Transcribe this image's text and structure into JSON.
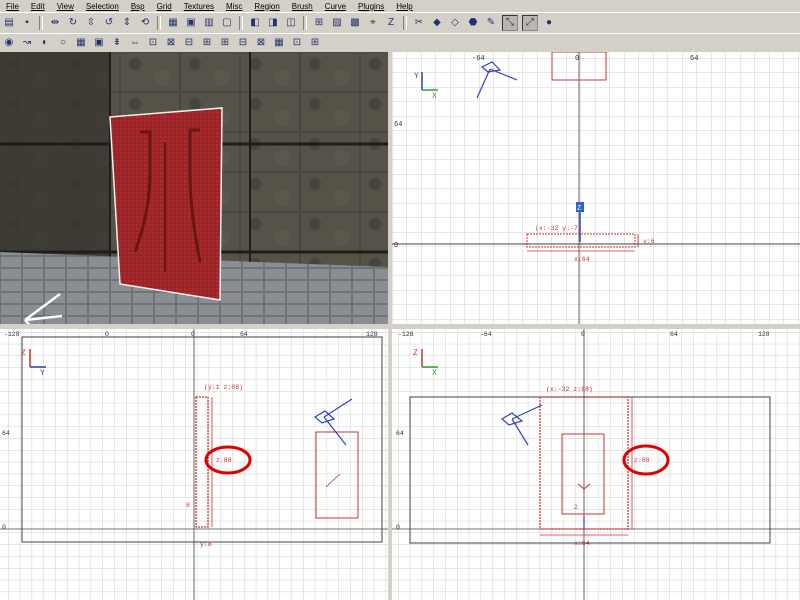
{
  "menu": [
    "File",
    "Edit",
    "View",
    "Selection",
    "Bsp",
    "Grid",
    "Textures",
    "Misc",
    "Region",
    "Brush",
    "Curve",
    "Plugins",
    "Help"
  ],
  "toolbar1": [
    {
      "icon": "open-folder-icon",
      "glyph": "▤"
    },
    {
      "icon": "save-icon",
      "glyph": "▪"
    },
    {
      "sep": true
    },
    {
      "icon": "flip-x-icon",
      "glyph": "⇹"
    },
    {
      "icon": "rotate-x-icon",
      "glyph": "↻"
    },
    {
      "icon": "flip-y-icon",
      "glyph": "⇳"
    },
    {
      "icon": "rotate-y-icon",
      "glyph": "↺"
    },
    {
      "icon": "flip-z-icon",
      "glyph": "⇕"
    },
    {
      "icon": "rotate-z-icon",
      "glyph": "⟲"
    },
    {
      "sep": true
    },
    {
      "icon": "select-complete-tall-icon",
      "glyph": "▦"
    },
    {
      "icon": "select-touching-icon",
      "glyph": "▣"
    },
    {
      "icon": "select-partial-tall-icon",
      "glyph": "▥"
    },
    {
      "icon": "select-inside-icon",
      "glyph": "▢"
    },
    {
      "sep": true
    },
    {
      "icon": "csg-subtract-icon",
      "glyph": "◧"
    },
    {
      "icon": "csg-merge-icon",
      "glyph": "◨"
    },
    {
      "icon": "hollow-icon",
      "glyph": "◫"
    },
    {
      "sep": true
    },
    {
      "icon": "change-views-icon",
      "glyph": "⊞"
    },
    {
      "icon": "texture-view-icon",
      "glyph": "▨"
    },
    {
      "icon": "cubic-clip-icon",
      "glyph": "▩"
    },
    {
      "icon": "camera-move-icon",
      "glyph": "⌖"
    },
    {
      "icon": "entity-icon",
      "glyph": "Z"
    },
    {
      "sep": true
    },
    {
      "icon": "clipper-icon",
      "glyph": "✂"
    },
    {
      "icon": "drag-edges-icon",
      "glyph": "◆"
    },
    {
      "icon": "drag-vertices-icon",
      "glyph": "◇"
    },
    {
      "icon": "patch-icon",
      "glyph": "⬣"
    },
    {
      "icon": "brush-icon",
      "glyph": "✎"
    },
    {
      "icon": "select-entity-icon",
      "glyph": "⤡",
      "pressed": true
    },
    {
      "icon": "scale-icon",
      "glyph": "⤢",
      "pressed": true
    },
    {
      "icon": "point-icon",
      "glyph": "●"
    }
  ],
  "toolbar2": [
    {
      "icon": "patch-select-icon",
      "glyph": "◉"
    },
    {
      "icon": "show-paths-icon",
      "glyph": "↝"
    },
    {
      "icon": "bend-icon",
      "glyph": "◐"
    },
    {
      "icon": "cap-icon",
      "glyph": "○"
    },
    {
      "icon": "matrix-icon",
      "glyph": "▦"
    },
    {
      "icon": "drill-icon",
      "glyph": "▣"
    },
    {
      "icon": "thicken-icon",
      "glyph": "⇟"
    },
    {
      "icon": "redisperse-icon",
      "glyph": "⇔"
    },
    {
      "icon": "weld-icon",
      "glyph": "⊡"
    },
    {
      "icon": "split-icon",
      "glyph": "⊠"
    },
    {
      "icon": "cap-cycle-icon",
      "glyph": "⊟"
    },
    {
      "icon": "invert-icon",
      "glyph": "⊞"
    },
    {
      "icon": "insert-row-icon",
      "glyph": "⊞"
    },
    {
      "icon": "delete-row-icon",
      "glyph": "⊟"
    },
    {
      "icon": "overlay-icon",
      "glyph": "⊠"
    },
    {
      "icon": "natural-icon",
      "glyph": "▦"
    },
    {
      "icon": "fit-icon",
      "glyph": "⊡"
    },
    {
      "icon": "texture-lock-icon",
      "glyph": "⊞"
    }
  ],
  "views": {
    "xy": {
      "top_ticks": [
        "-64",
        "0",
        "64"
      ],
      "left_ticks": [
        "64",
        "0"
      ],
      "axis_v": "Y",
      "axis_h": "X",
      "brush_tag": "(x:-32  y:-7)",
      "brush_width": "x:64",
      "brush_depth": "y:6",
      "entity_tag": "Z"
    },
    "yz": {
      "top_ticks": [
        "-128",
        "-64",
        "0",
        "64",
        "128"
      ],
      "left_ticks": [
        "64",
        "0"
      ],
      "axis_v": "Z",
      "axis_h": "Y",
      "brush_tag": "(y:1  z:88)",
      "brush_height": "z:88",
      "left_value": "8",
      "bottom_value": "y:8"
    },
    "xz": {
      "top_ticks": [
        "-128",
        "-64",
        "0",
        "64",
        "128"
      ],
      "left_ticks": [
        "64",
        "0"
      ],
      "axis_v": "Z",
      "axis_h": "X",
      "brush_tag": "(x:-32  z:88)",
      "brush_height": "z:88",
      "brush_width": "x:64",
      "bottom_value": "2"
    }
  },
  "colors": {
    "brush": "#c83030",
    "grid": "#c8c8c8",
    "axis_v": "#c83030",
    "axis_h_xy": "#30a030",
    "camera": "#3040c0",
    "highlight": "#e00000"
  }
}
